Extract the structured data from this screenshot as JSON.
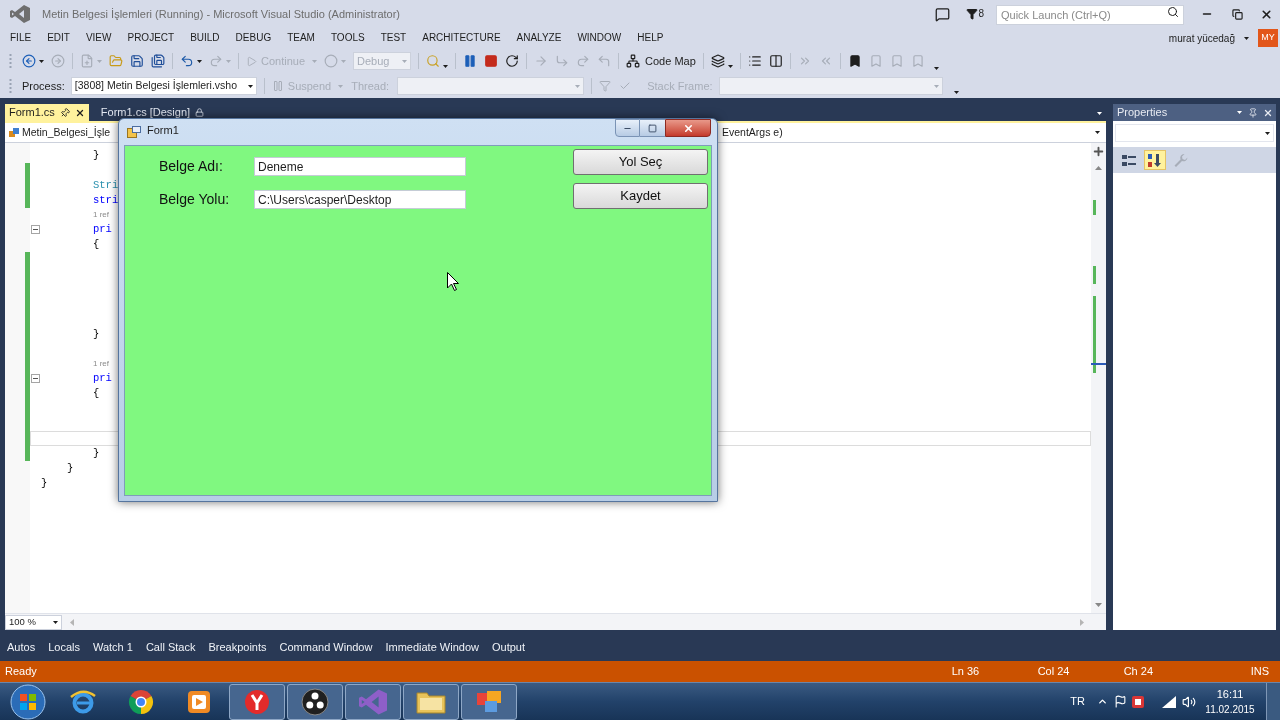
{
  "window": {
    "title": "Metin Belgesi İşlemleri (Running) - Microsoft Visual Studio (Administrator)"
  },
  "title_bar": {
    "notification_count": "8",
    "quick_launch": {
      "placeholder": "Quick Launch (Ctrl+Q)"
    }
  },
  "menu": [
    "FILE",
    "EDIT",
    "VIEW",
    "PROJECT",
    "BUILD",
    "DEBUG",
    "TEAM",
    "TOOLS",
    "TEST",
    "ARCHITECTURE",
    "ANALYZE",
    "WINDOW",
    "HELP"
  ],
  "account": {
    "name": "murat yücedağ",
    "initials": "MY"
  },
  "standard_toolbar": {
    "groups": [
      [
        {
          "kind": "back",
          "disabled": false
        },
        {
          "kind": "forward",
          "disabled": true
        }
      ],
      [
        {
          "kind": "new_project",
          "disabled": true
        },
        {
          "kind": "open",
          "disabled": false
        },
        {
          "kind": "save",
          "disabled": false
        },
        {
          "kind": "save_all",
          "disabled": false
        }
      ],
      [
        {
          "kind": "undo",
          "disabled": false
        },
        {
          "kind": "redo",
          "disabled": true
        }
      ],
      [
        {
          "kind": "continue",
          "label": "Continue",
          "disabled": true
        },
        {
          "kind": "attach",
          "disabled": true
        },
        {
          "kind": "configuration",
          "value": "Debug",
          "disabled": true
        }
      ],
      [
        {
          "kind": "find",
          "disabled": false
        }
      ],
      [
        {
          "kind": "pause",
          "disabled": false
        },
        {
          "kind": "stop",
          "disabled": false
        },
        {
          "kind": "restart",
          "disabled": false
        }
      ],
      [
        {
          "kind": "show_next",
          "disabled": true
        },
        {
          "kind": "step_into",
          "disabled": true
        },
        {
          "kind": "step_over",
          "disabled": true
        },
        {
          "kind": "step_out",
          "disabled": true
        }
      ],
      [
        {
          "kind": "code_map",
          "label": "Code Map",
          "disabled": false
        }
      ],
      [
        {
          "kind": "layers",
          "disabled": false
        }
      ],
      [
        {
          "kind": "list",
          "disabled": false
        },
        {
          "kind": "columns",
          "disabled": false
        }
      ],
      [
        {
          "kind": "indent",
          "disabled": true
        },
        {
          "kind": "outdent",
          "disabled": true
        }
      ],
      [
        {
          "kind": "bookmark",
          "disabled": false
        },
        {
          "kind": "bookmark",
          "disabled": true
        },
        {
          "kind": "bookmark",
          "disabled": true
        },
        {
          "kind": "bookmark",
          "disabled": true
        }
      ]
    ]
  },
  "debug_location_toolbar": {
    "process": {
      "label": "Process:",
      "value": "[3808] Metin Belgesi İşlemleri.vsho"
    },
    "suspend": {
      "label": "Suspend",
      "disabled": true
    },
    "thread": {
      "label": "Thread:",
      "disabled": true
    },
    "thread_filters": {
      "disabled": true
    },
    "stack_frame": {
      "label": "Stack Frame:",
      "disabled": true
    }
  },
  "editor": {
    "tabs": [
      {
        "label": "Form1.cs",
        "selected": true
      },
      {
        "label": "Form1.cs [Design]",
        "selected": false
      }
    ],
    "navigation": {
      "project": "Metin_Belgesi_İşle",
      "member": "EventArgs e)"
    },
    "code": [
      {
        "kind": "scope",
        "children": [
          {
            "kind": "scope",
            "children": [
              {
                "kind": "plain",
                "text": "}",
                "changed": false,
                "current": false
              },
              {
                "kind": "blank",
                "changed": true,
                "current": false
              },
              {
                "kind": "type",
                "text": "Stri",
                "changed": true,
                "current": false
              },
              {
                "kind": "keyword",
                "text": "stri",
                "changed": true,
                "current": false
              },
              {
                "kind": "codelens",
                "text": "1 ref",
                "changed": false,
                "current": false
              },
              {
                "kind": "member",
                "text": "pri",
                "changed": false,
                "current": false
              },
              {
                "kind": "plain",
                "text": "{",
                "changed": false,
                "current": false
              },
              {
                "kind": "blank",
                "changed": true,
                "current": false
              },
              {
                "kind": "blank",
                "changed": true,
                "current": false
              },
              {
                "kind": "blank",
                "changed": true,
                "current": false
              },
              {
                "kind": "blank",
                "changed": true,
                "current": false
              },
              {
                "kind": "blank",
                "changed": true,
                "current": false
              },
              {
                "kind": "plain",
                "text": "}",
                "changed": true,
                "current": false
              },
              {
                "kind": "blank",
                "changed": true,
                "current": false
              },
              {
                "kind": "codelens",
                "text": "1 ref",
                "changed": true,
                "current": false
              },
              {
                "kind": "member",
                "text": "pri",
                "changed": true,
                "current": false
              },
              {
                "kind": "plain",
                "text": "{",
                "changed": true,
                "current": false
              },
              {
                "kind": "blank",
                "changed": true,
                "current": false
              },
              {
                "kind": "blank",
                "changed": true,
                "current": false
              },
              {
                "kind": "blank",
                "changed": true,
                "current": true
              },
              {
                "kind": "plain",
                "text": "}",
                "changed": true,
                "current": false
              }
            ]
          },
          {
            "kind": "plain",
            "text": "}",
            "changed": false,
            "current": false
          }
        ]
      },
      {
        "kind": "plain",
        "text": "}",
        "changed": false,
        "current": false
      }
    ],
    "zoom": "100 %"
  },
  "properties": {
    "title": "Properties",
    "views": [
      {
        "kind": "categorized",
        "selected": false,
        "disabled": false
      },
      {
        "kind": "alphabetical",
        "selected": true,
        "disabled": false
      },
      {
        "kind": "pages",
        "selected": false,
        "disabled": true
      }
    ]
  },
  "form_window": {
    "title": "Form1",
    "fields": [
      {
        "label": "Belge Adı:",
        "value": "Deneme"
      },
      {
        "label": "Belge Yolu:",
        "value": "C:\\Users\\casper\\Desktop"
      }
    ],
    "buttons": [
      "Yol Seç",
      "Kaydet"
    ]
  },
  "tool_tabs": [
    {
      "label": "Autos",
      "selected": false
    },
    {
      "label": "Locals",
      "selected": false
    },
    {
      "label": "Watch 1",
      "selected": false
    },
    {
      "label": "Call Stack",
      "selected": false
    },
    {
      "label": "Breakpoints",
      "selected": false
    },
    {
      "label": "Command Window",
      "selected": false
    },
    {
      "label": "Immediate Window",
      "selected": false
    },
    {
      "label": "Output",
      "selected": false
    }
  ],
  "status_bar": {
    "text": "Ready",
    "line": "Ln 36",
    "column": "Col 24",
    "char": "Ch 24",
    "mode": "INS"
  },
  "taskbar": {
    "apps": [
      {
        "kind": "ring",
        "running": false
      },
      {
        "kind": "wheel",
        "running": false
      },
      {
        "kind": "play_tile",
        "running": false
      },
      {
        "kind": "fork_disc",
        "running": true
      },
      {
        "kind": "three_dots",
        "running": true
      },
      {
        "kind": "ribbon",
        "running": true
      },
      {
        "kind": "folder",
        "running": true
      },
      {
        "kind": "tiles",
        "running": true
      }
    ],
    "language": "TR",
    "time": "16:11",
    "date": "11.02.2015"
  }
}
